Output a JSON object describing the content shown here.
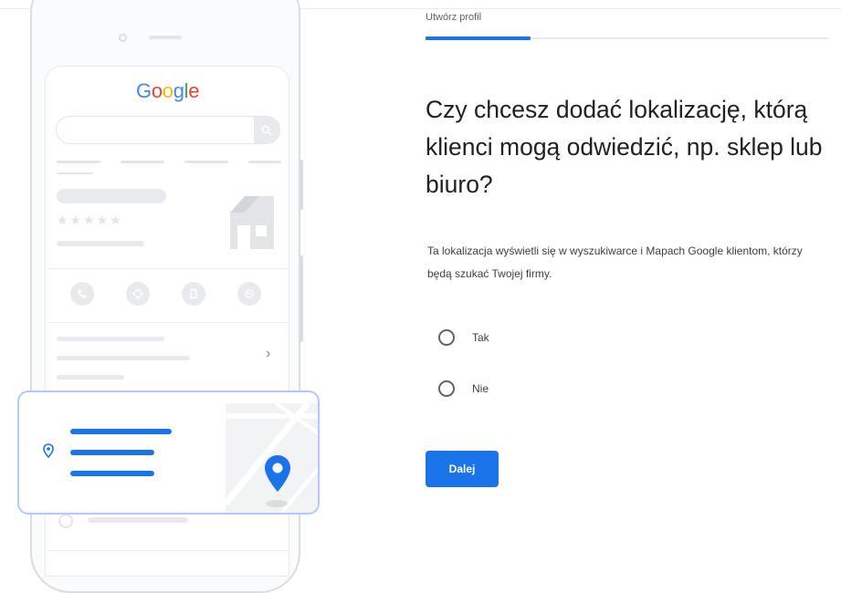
{
  "header": {
    "step_label": "Utwórz profil",
    "progress_fraction": 0.26
  },
  "main": {
    "question": "Czy chcesz dodać lokalizację, którą klienci mogą odwiedzić, np. sklep lub biuro?",
    "description": "Ta lokalizacja wyświetli się w wyszukiwarce i Mapach Google klientom, którzy będą szukać Twojej firmy.",
    "options": [
      {
        "label": "Tak",
        "selected": false
      },
      {
        "label": "Nie",
        "selected": false
      }
    ],
    "next_label": "Dalej"
  },
  "illustration": {
    "logo_text": "Google",
    "logo_colors": [
      "#4285F4",
      "#EA4335",
      "#FBBC05",
      "#4285F4",
      "#34A853",
      "#EA4335"
    ],
    "stars_text": "★★★★★",
    "chevron_text": "›",
    "action_icons": [
      "phone-icon",
      "directions-icon",
      "website-icon",
      "share-icon"
    ]
  },
  "colors": {
    "accent": "#1a73e8",
    "card_border": "#aecbfa",
    "text_primary": "#202124",
    "text_secondary": "#3c4043"
  }
}
